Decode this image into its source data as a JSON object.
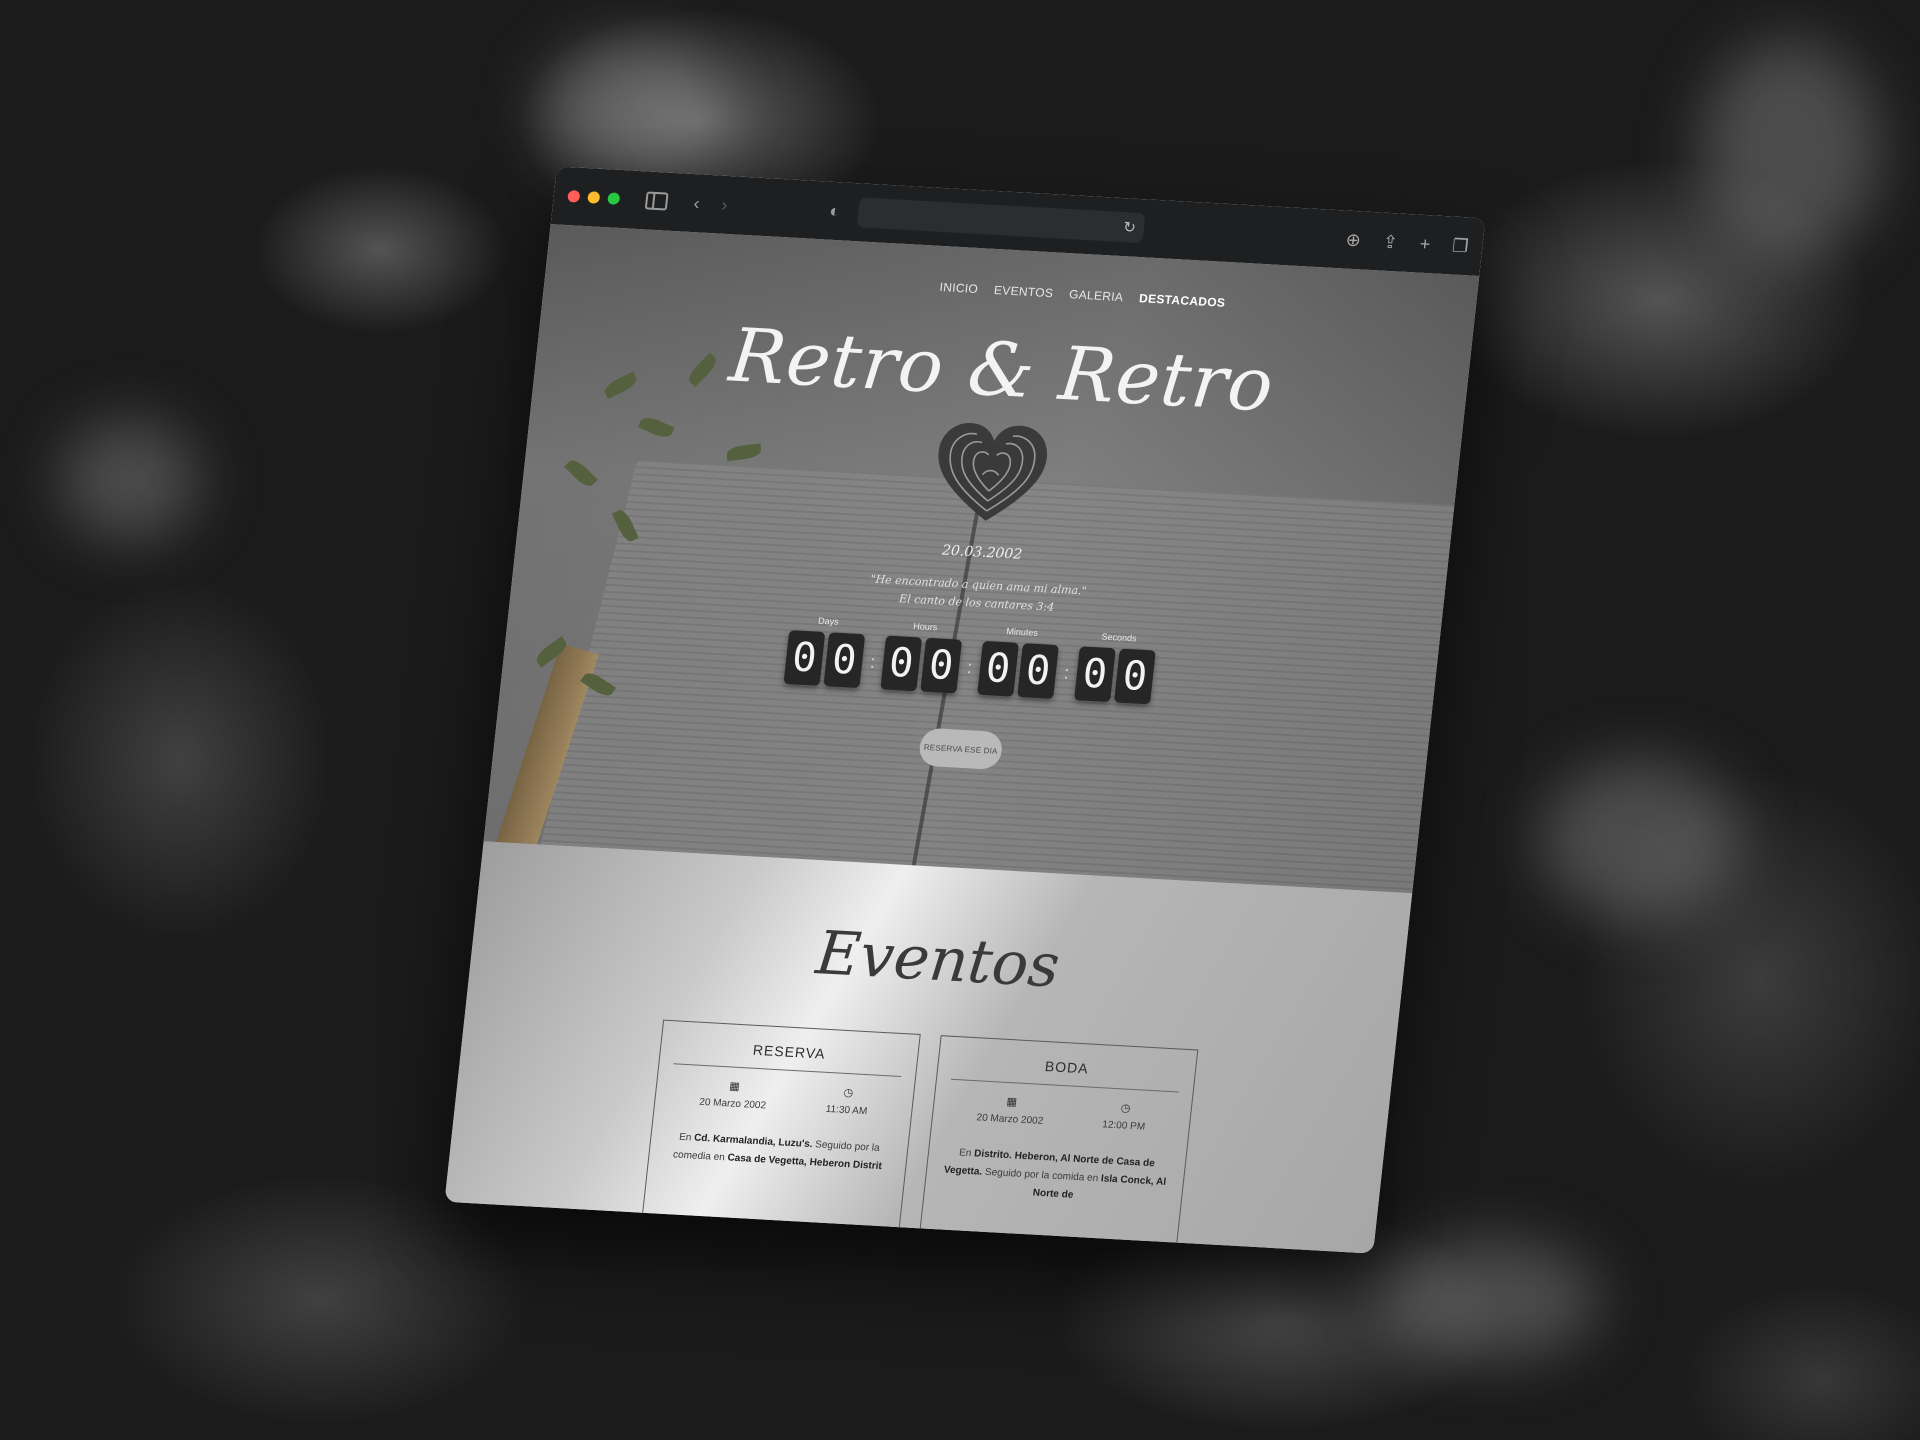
{
  "browser": {
    "address_value": "",
    "icons": [
      "sidebar-icon",
      "back-icon",
      "forward-icon",
      "shield-icon",
      "reload-icon",
      "download-icon",
      "share-icon",
      "new-tab-icon",
      "tabs-overview-icon"
    ]
  },
  "nav": {
    "items": [
      {
        "label": "INICIO"
      },
      {
        "label": "EVENTOS"
      },
      {
        "label": "GALERIA"
      },
      {
        "label": "DESTACADOS"
      }
    ]
  },
  "hero": {
    "couple_name": "Retro & Retro",
    "date": "20.03.2002",
    "quote_line1": "\"He encontrado a quien ama mi alma.\"",
    "quote_line2": "El canto de los cantares 3:4",
    "countdown": {
      "days_label": "Days",
      "hours_label": "Hours",
      "minutes_label": "Minutes",
      "seconds_label": "Seconds",
      "days": [
        "0",
        "0"
      ],
      "hours": [
        "0",
        "0"
      ],
      "minutes": [
        "0",
        "0"
      ],
      "seconds": [
        "0",
        "0"
      ]
    },
    "cta_label": "RESERVA ESE DIA"
  },
  "events": {
    "title": "Eventos",
    "cards": [
      {
        "title": "RESERVA",
        "date": "20 Marzo 2002",
        "time": "11:30 AM",
        "body_prefix": "En ",
        "body_bold1": "Cd. Karmalandia, Luzu's.",
        "body_mid": " Seguido por la comedia en ",
        "body_bold2": "Casa de Vegetta, Heberon Distrit"
      },
      {
        "title": "BODA",
        "date": "20 Marzo 2002",
        "time": "12:00 PM",
        "body_prefix": "En ",
        "body_bold1": "Distrito. Heberon, Al Norte de Casa de Vegetta.",
        "body_mid": " Seguido por la comida en ",
        "body_bold2": "Isla Conck, Al Norte de"
      }
    ]
  }
}
